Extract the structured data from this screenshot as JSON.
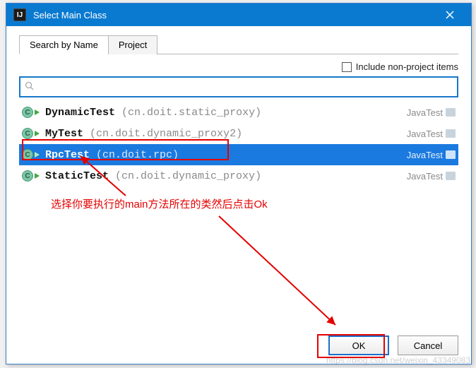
{
  "titlebar": {
    "title": "Select Main Class",
    "app_icon_text": "IJ"
  },
  "tabs": {
    "search_by_name": "Search by Name",
    "project": "Project",
    "active": 0
  },
  "options": {
    "include_nonproject_label": "Include non-project items",
    "include_nonproject_checked": false
  },
  "search": {
    "placeholder": "",
    "value": ""
  },
  "list": {
    "items": [
      {
        "name": "DynamicTest",
        "pkg": "(cn.doit.static_proxy)",
        "module": "JavaTest",
        "selected": false
      },
      {
        "name": "MyTest",
        "pkg": "(cn.doit.dynamic_proxy2)",
        "module": "JavaTest",
        "selected": false
      },
      {
        "name": "RpcTest",
        "pkg": "(cn.doit.rpc)",
        "module": "JavaTest",
        "selected": true
      },
      {
        "name": "StaticTest",
        "pkg": "(cn.doit.dynamic_proxy)",
        "module": "JavaTest",
        "selected": false
      }
    ]
  },
  "buttons": {
    "ok": "OK",
    "cancel": "Cancel"
  },
  "annotation": {
    "text": "选择你要执行的main方法所在的类然后点击Ok"
  },
  "watermark": "https://blog.csdn.net/weixin_43349083"
}
